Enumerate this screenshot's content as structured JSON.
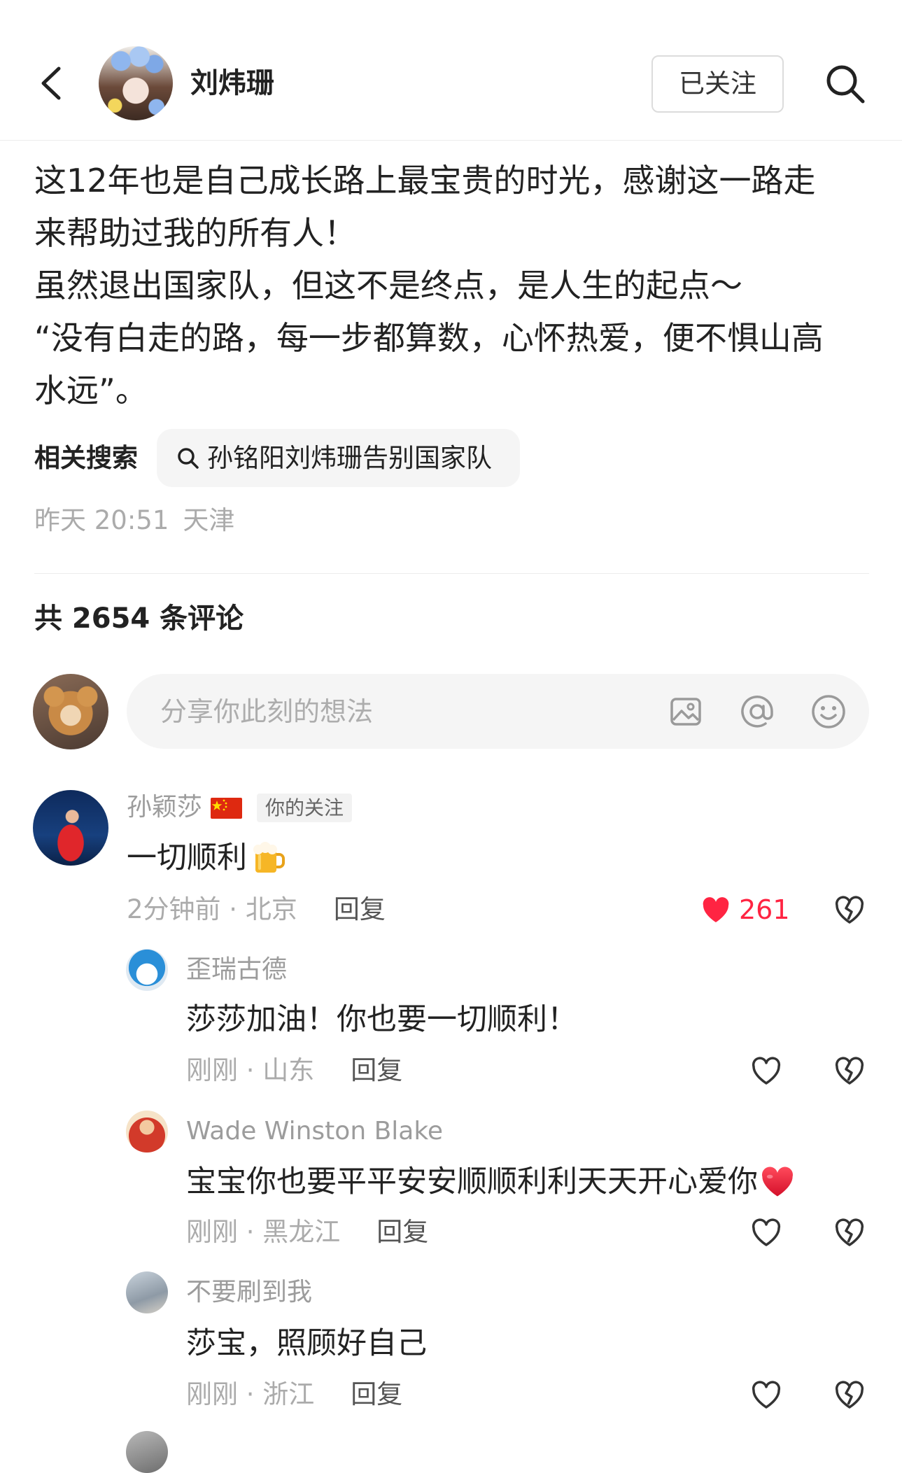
{
  "header": {
    "author_name": "刘炜珊",
    "follow_label": "已关注"
  },
  "icons": {
    "back": "chevron-left-icon",
    "search": "search-icon",
    "related_search": "magnifier-icon",
    "insert_image": "image-icon",
    "mention": "at-sign-icon",
    "emoji": "smiley-icon",
    "like": "heart-icon",
    "dislike": "broken-heart-icon",
    "flag": "china-flag-icon",
    "beer": "beer-mug-icon",
    "red_heart": "red-heart-icon"
  },
  "post": {
    "lines": [
      "这12年也是自己成长路上最宝贵的时光，感谢这一路走",
      "来帮助过我的所有人！",
      "虽然退出国家队，但这不是终点，是人生的起点～",
      "“没有白走的路，每一步都算数，心怀热爱，便不惧山高",
      "水远”。"
    ],
    "related_label": "相关搜索",
    "related_query": "孙铭阳刘炜珊告别国家队",
    "timestamp": "昨天 20:51",
    "location": "天津"
  },
  "comments_section": {
    "count_text": "共 2654 条评论",
    "input_placeholder": "分享你此刻的想法"
  },
  "comments": [
    {
      "author": "孙颖莎",
      "badge": "你的关注",
      "content": "一切顺利",
      "meta": "2分钟前 · 北京",
      "reply_label": "回复",
      "likes": "261",
      "liked": true,
      "replies": [
        {
          "author": "歪瑞古德",
          "content": "莎莎加油！你也要一切顺利！",
          "meta": "刚刚 · 山东",
          "reply_label": "回复"
        },
        {
          "author": "Wade Winston Blake",
          "content": "宝宝你也要平平安安顺顺利利天天开心爱你",
          "meta": "刚刚 · 黑龙江",
          "reply_label": "回复"
        },
        {
          "author": "不要刷到我",
          "content": "莎宝，照顾好自己",
          "meta": "刚刚 · 浙江",
          "reply_label": "回复"
        }
      ]
    }
  ],
  "colors": {
    "accent": "#ff2442",
    "text": "#222222",
    "muted": "#ababab",
    "pill_bg": "#f5f5f5"
  }
}
